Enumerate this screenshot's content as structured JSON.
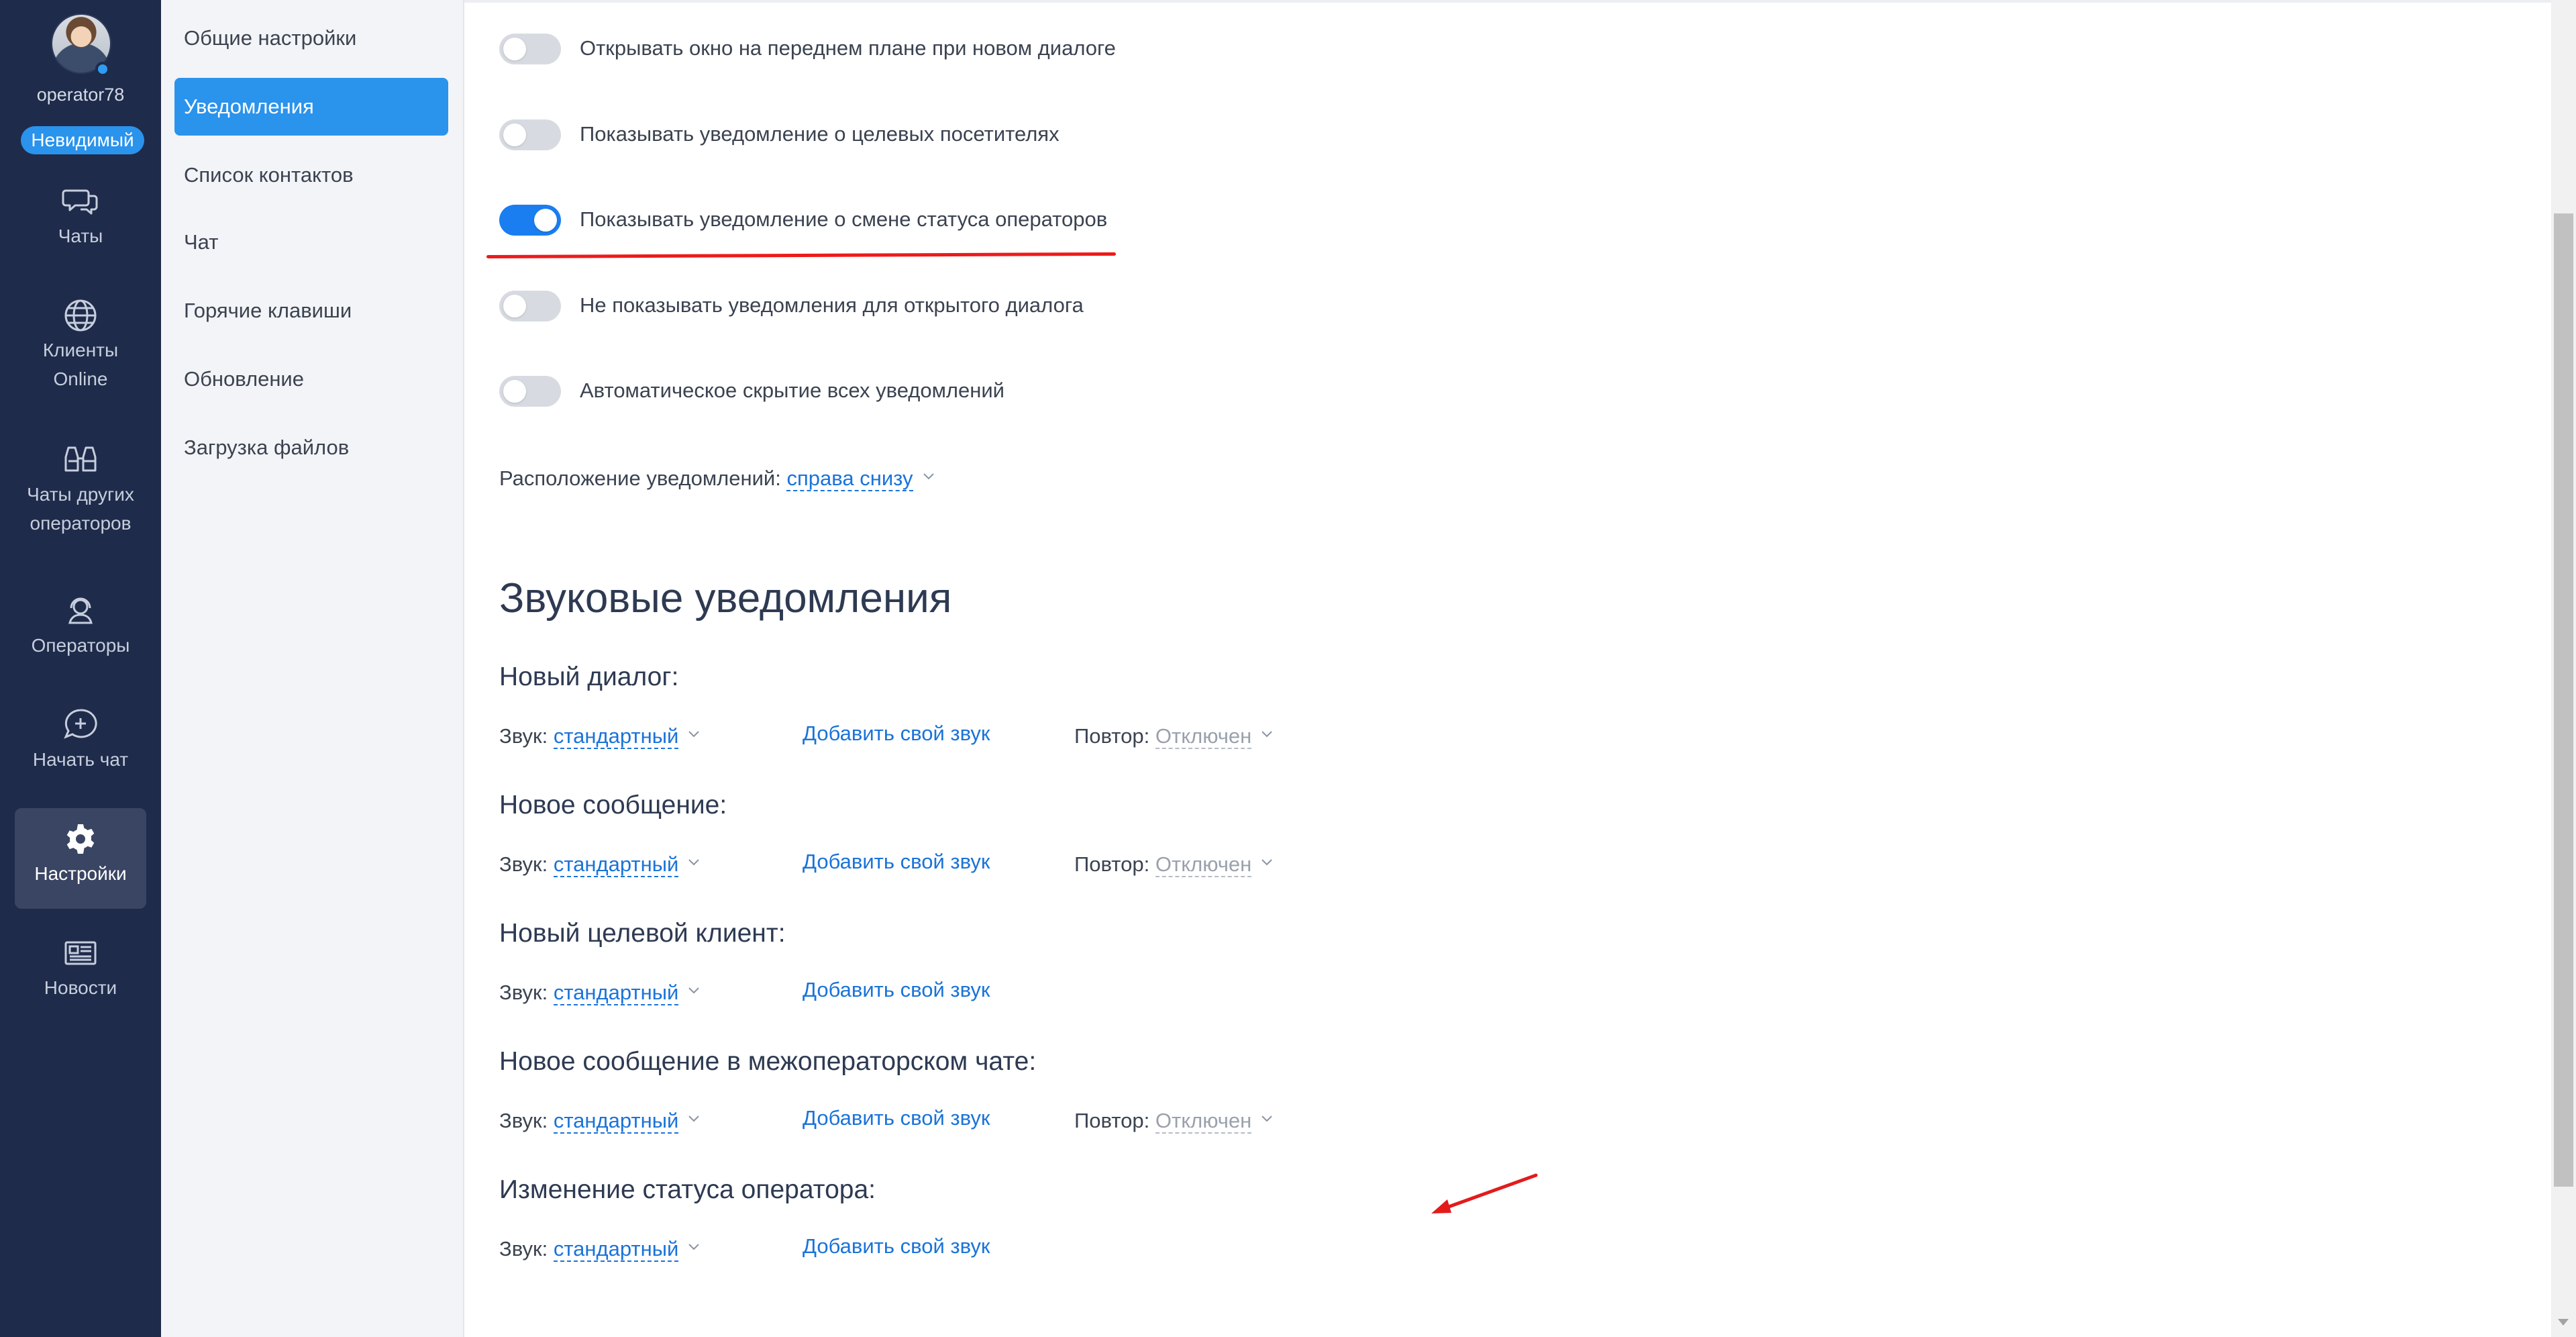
{
  "profile": {
    "name": "operator78",
    "status": "Невидимый"
  },
  "rail": [
    {
      "label": "Чаты",
      "icon": "chats-icon"
    },
    {
      "label": "Клиенты Online",
      "icon": "globe-icon"
    },
    {
      "label": "Чаты других операторов",
      "icon": "binoculars-icon"
    },
    {
      "label": "Операторы",
      "icon": "operator-headset-icon"
    },
    {
      "label": "Начать чат",
      "icon": "chat-plus-icon"
    },
    {
      "label": "Настройки",
      "icon": "gear-icon",
      "active": true
    },
    {
      "label": "Новости",
      "icon": "newspaper-icon"
    }
  ],
  "menu": [
    "Общие настройки",
    "Уведомления",
    "Список контактов",
    "Чат",
    "Горячие клавиши",
    "Обновление",
    "Загрузка файлов"
  ],
  "menu_active": "Уведомления",
  "toggles": [
    {
      "label": "Открывать окно на переднем плане при новом диалоге",
      "on": false
    },
    {
      "label": "Показывать уведомление о целевых посетителях",
      "on": false
    },
    {
      "label": "Показывать уведомление о смене статуса операторов",
      "on": true
    },
    {
      "label": "Не показывать уведомления для открытого диалога",
      "on": false
    },
    {
      "label": "Автоматическое скрытие всех уведомлений",
      "on": false
    }
  ],
  "placement": {
    "label": "Расположение уведомлений:",
    "value": "справа снизу"
  },
  "sound_section": {
    "title": "Звуковые уведомления",
    "sound_label": "Звук:",
    "add_label": "Добавить свой звук",
    "repeat_label": "Повтор:",
    "groups": [
      {
        "title": "Новый диалог:",
        "sound": "стандартный",
        "repeat": "Отключен"
      },
      {
        "title": "Новое сообщение:",
        "sound": "стандартный",
        "repeat": "Отключен"
      },
      {
        "title": "Новый целевой клиент:",
        "sound": "стандартный"
      },
      {
        "title": "Новое сообщение в межоператорском чате:",
        "sound": "стандартный",
        "repeat": "Отключен"
      },
      {
        "title": "Изменение статуса оператора:",
        "sound": "стандартный"
      }
    ]
  },
  "colors": {
    "rail": "#1f2b4a",
    "accent": "#2a93ec",
    "link": "#1a73d9",
    "annotation": "#ee1a1a"
  }
}
